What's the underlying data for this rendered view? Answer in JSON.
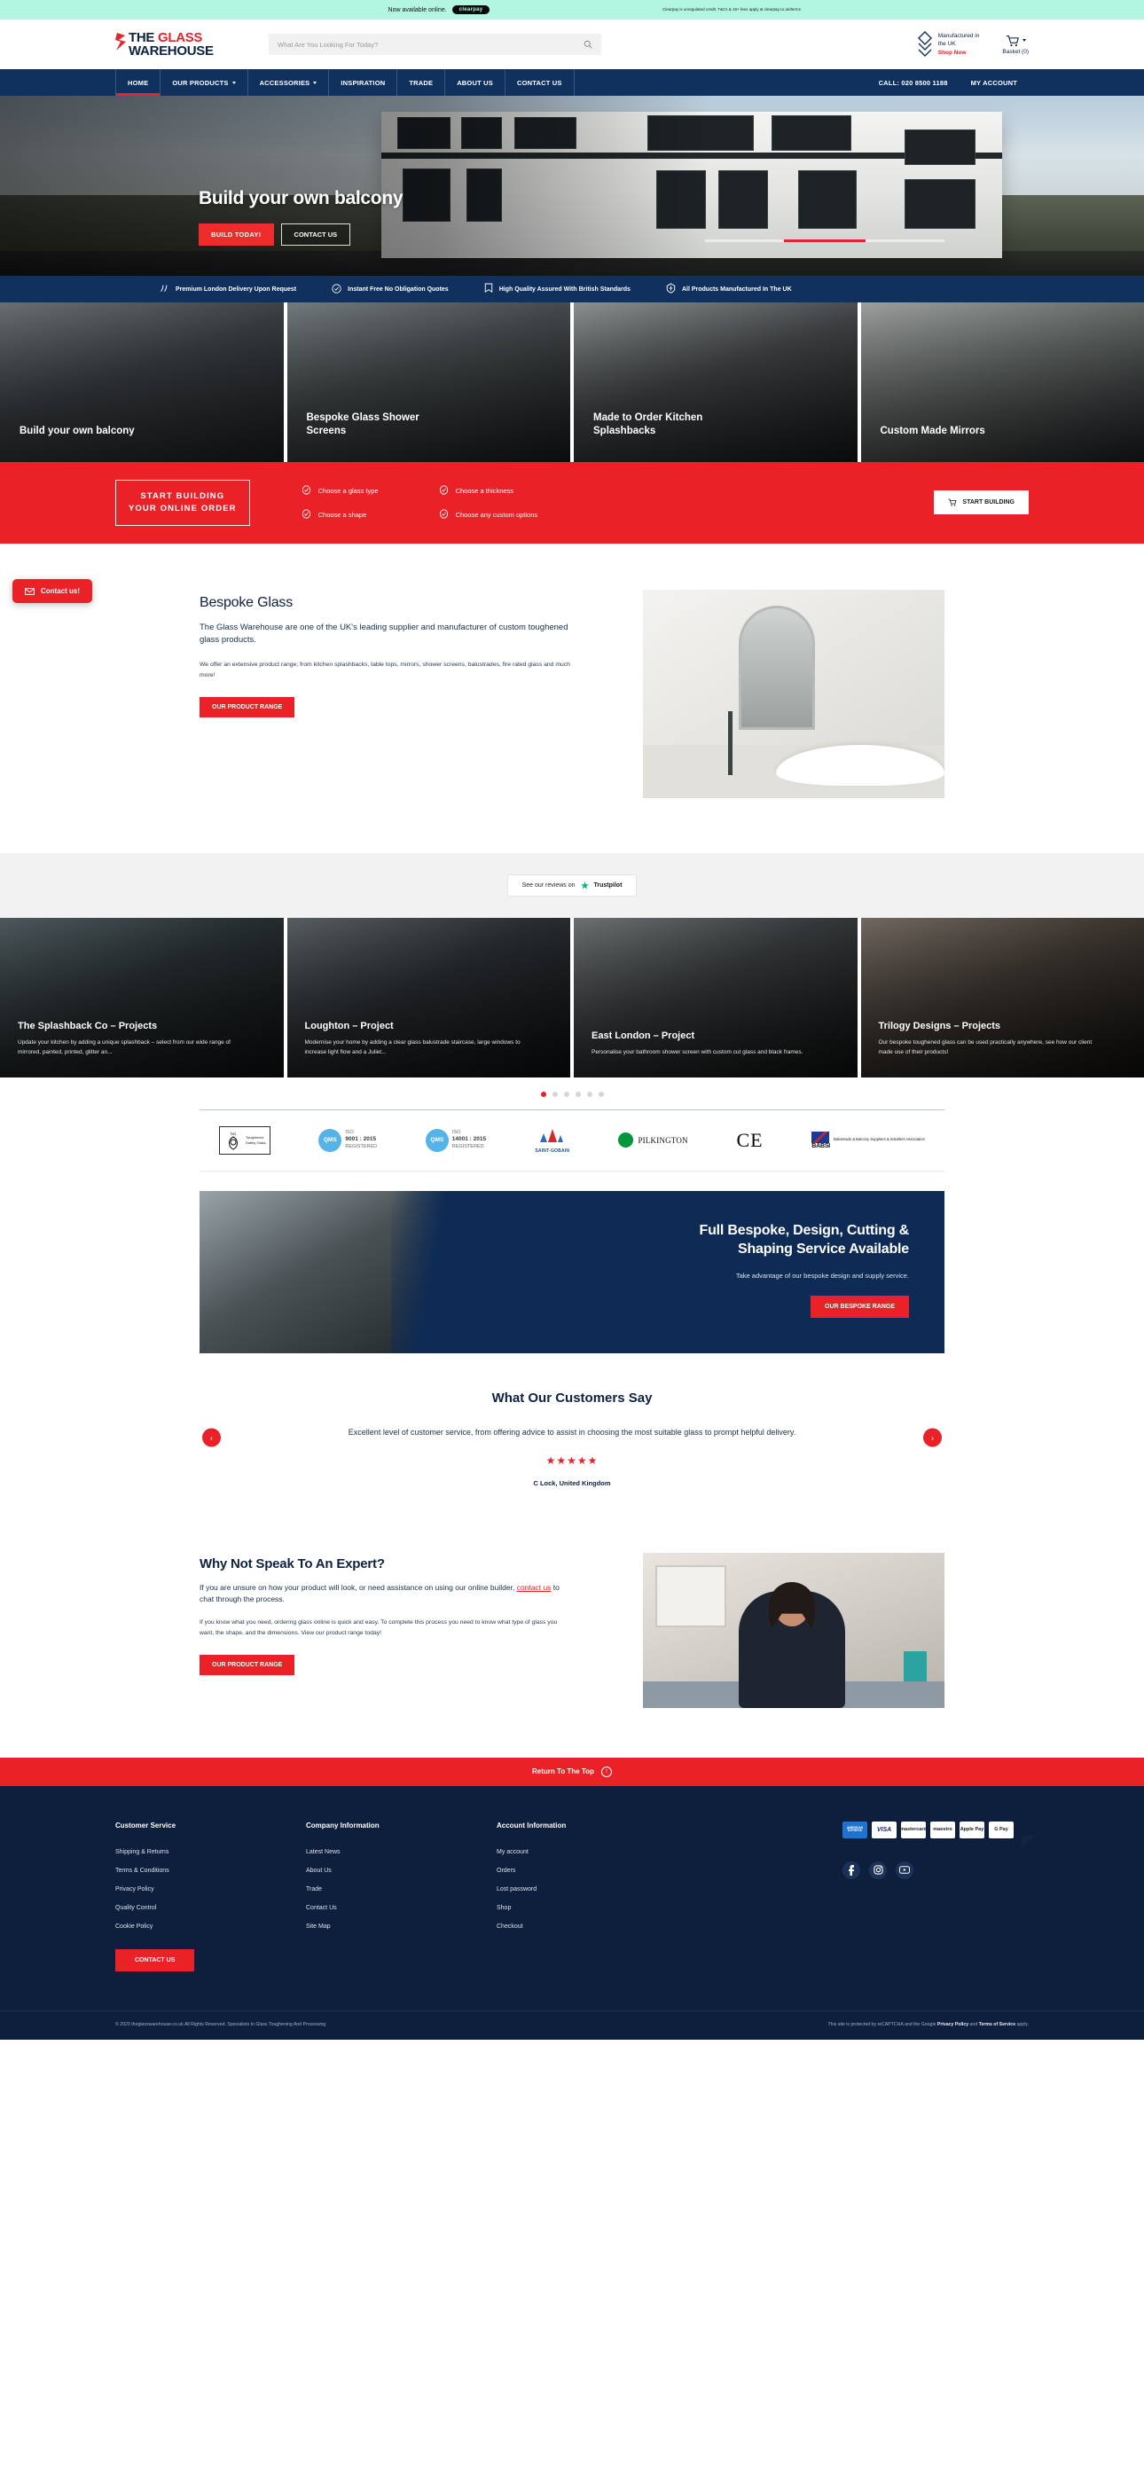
{
  "announce": {
    "text": "Now available online.",
    "badge": "clearpay",
    "legal": "Clearpay is unregulated credit. T&Cs & 18+ fees apply at clearpay.co.uk/terms"
  },
  "header": {
    "logo_line1_a": "THE ",
    "logo_line1_b": "GLASS",
    "logo_line2": "WAREHOUSE",
    "search_placeholder": "What Are You Looking For Today?",
    "search_value": "",
    "search_icon": "search-icon",
    "made_line1": "Manufactured in",
    "made_line2": "the UK",
    "made_shop": "Shop Now",
    "basket_label": "Basket (0)",
    "basket_icon": "shopping-cart-icon"
  },
  "nav": {
    "items": [
      {
        "label": "HOME",
        "caret": false,
        "active": true
      },
      {
        "label": "OUR PRODUCTS",
        "caret": true,
        "active": false
      },
      {
        "label": "ACCESSORIES",
        "caret": true,
        "active": false
      },
      {
        "label": "INSPIRATION",
        "caret": false,
        "active": false
      },
      {
        "label": "TRADE",
        "caret": false,
        "active": false
      },
      {
        "label": "ABOUT US",
        "caret": false,
        "active": false
      },
      {
        "label": "CONTACT US",
        "caret": false,
        "active": false
      }
    ],
    "phone": "CALL: 020 8500 1188",
    "account": "MY ACCOUNT"
  },
  "hero": {
    "title": "Build your own balcony",
    "cta_primary": "BUILD TODAY!",
    "cta_secondary": "CONTACT US"
  },
  "trust": {
    "items": [
      {
        "icon": "delivery-truck-icon",
        "label": "Premium London Delivery Upon Request"
      },
      {
        "icon": "check-circle-icon",
        "label": "Instant Free No Obligation Quotes"
      },
      {
        "icon": "ribbon-badge-icon",
        "label": "High Quality Assured With British Standards"
      },
      {
        "icon": "uk-shield-icon",
        "label": "All Products Manufactured In The UK"
      }
    ]
  },
  "categories": [
    {
      "title": "Build your own balcony"
    },
    {
      "title": "Bespoke Glass Shower Screens"
    },
    {
      "title": "Made to Order Kitchen Splashbacks"
    },
    {
      "title": "Custom Made Mirrors"
    }
  ],
  "float_contact": {
    "label": "Contact us!",
    "icon": "envelope-icon"
  },
  "build": {
    "badge_line1": "START BUILDING",
    "badge_line2": "YOUR ONLINE ORDER",
    "steps_col1": [
      "Choose a glass type",
      "Choose a shape"
    ],
    "steps_col2": [
      "Choose a thickness",
      "Choose any custom options"
    ],
    "cta": "START BUILDING",
    "cta_icon": "shopping-cart-icon"
  },
  "bespoke": {
    "heading": "Bespoke Glass",
    "lead": "The Glass Warehouse are one of the UK's leading supplier and manufacturer of custom toughened glass products.",
    "body": "We offer an extensive product range; from kitchen splashbacks, table tops, mirrors, shower screens, balustrades, fire rated glass and much more!",
    "cta": "OUR PRODUCT RANGE"
  },
  "trustpilot": {
    "prefix": "See our reviews on",
    "name": "Trustpilot",
    "icon": "trustpilot-star-icon"
  },
  "projects": [
    {
      "title": "The Splashback Co – Projects",
      "desc": "Update your kitchen by adding a unique splashback – select from our wide range of mirrored, painted, printed, glitter an..."
    },
    {
      "title": "Loughton – Project",
      "desc": "Modernise your home by adding a clear glass balustrade staircase, large windows to increase light flow and a Juliet..."
    },
    {
      "title": "East London – Project",
      "desc": "Personalise your bathroom shower screen with custom cut glass and black frames."
    },
    {
      "title": "Trilogy Designs – Projects",
      "desc": "Our bespoke toughened glass can be used practically anywhere, see how our client made use of their products!"
    }
  ],
  "project_dots": {
    "count": 6,
    "active_index": 0
  },
  "certifications": [
    {
      "name": "bsi-toughened-safety-glass",
      "label_top": "Toughened",
      "label_bottom": "Safety Glass",
      "mark": "bsi",
      "sub": "KITEMARK"
    },
    {
      "name": "qms-iso-9001-2015",
      "mark": "QMS",
      "iso_line1": "ISO",
      "iso_line2": "9001 : 2015",
      "iso_line3": "REGISTERED"
    },
    {
      "name": "qms-iso-14001-2015",
      "mark": "QMS",
      "iso_line1": "ISO",
      "iso_line2": "14001 : 2015",
      "iso_line3": "REGISTERED"
    },
    {
      "name": "saint-gobain",
      "mark": "SAINT-GOBAIN"
    },
    {
      "name": "pilkington",
      "mark": "PILKINGTON"
    },
    {
      "name": "ce-mark",
      "mark": "CE"
    },
    {
      "name": "babsi",
      "mark": "BABSI",
      "desc": "Balustrade & Balcony Suppliers & Installers Association"
    }
  ],
  "banner": {
    "heading_line1": "Full Bespoke, Design, Cutting &",
    "heading_line2": "Shaping Service Available",
    "sub": "Take advantage of our bespoke design and supply service.",
    "cta": "OUR BESPOKE RANGE"
  },
  "testimonial": {
    "heading": "What Our Customers Say",
    "quote": "Excellent level of customer service, from offering advice to assist in choosing the most suitable glass to prompt helpful delivery.",
    "stars": "★★★★★",
    "rating": 5,
    "author": "C Lock, United Kingdom",
    "prev_icon": "chevron-left-icon",
    "next_icon": "chevron-right-icon"
  },
  "expert": {
    "heading": "Why Not Speak To An Expert?",
    "lead_a": "If you are unsure on how your product will look, or need assistance on using our online builder, ",
    "lead_link": "contact us",
    "lead_b": " to chat through the process.",
    "body": "If you know what you need, ordering glass online is quick and easy. To complete this process you need to know what type of glass you want, the shape, and the dimensions. View our product range today!",
    "cta": "OUR PRODUCT RANGE"
  },
  "return_top": {
    "label": "Return To The Top",
    "icon": "arrow-up-circle-icon"
  },
  "footer": {
    "columns": [
      {
        "heading": "Customer Service",
        "links": [
          "Shipping & Returns",
          "Terms & Conditions",
          "Privacy Policy",
          "Quality Control",
          "Cookie Policy"
        ],
        "cta": "CONTACT US"
      },
      {
        "heading": "Company Information",
        "links": [
          "Latest News",
          "About Us",
          "Trade",
          "Contact Us",
          "Site Map"
        ]
      },
      {
        "heading": "Account Information",
        "links": [
          "My account",
          "Orders",
          "Lost password",
          "Shop",
          "Checkout"
        ]
      }
    ],
    "payments": [
      "AMERICAN EXPRESS",
      "VISA",
      "mastercard",
      "maestro",
      "Apple Pay",
      "G Pay"
    ],
    "socials": [
      "facebook-icon",
      "instagram-icon",
      "youtube-icon"
    ],
    "copyright": "© 2023 theglasswarehouse.co.uk All Rights Reserved. Specialists In Glass Toughening And Processing",
    "recaptcha_a": "This site is protected by reCAPTCHA and the Google ",
    "recaptcha_privacy": "Privacy Policy",
    "recaptcha_and": " and ",
    "recaptcha_terms": "Terms of Service",
    "recaptcha_b": " apply."
  },
  "colors": {
    "brand_navy": "#10315e",
    "brand_red": "#ea2127",
    "footer_navy": "#0d1f3c",
    "announce_mint": "#b2f5e0"
  }
}
